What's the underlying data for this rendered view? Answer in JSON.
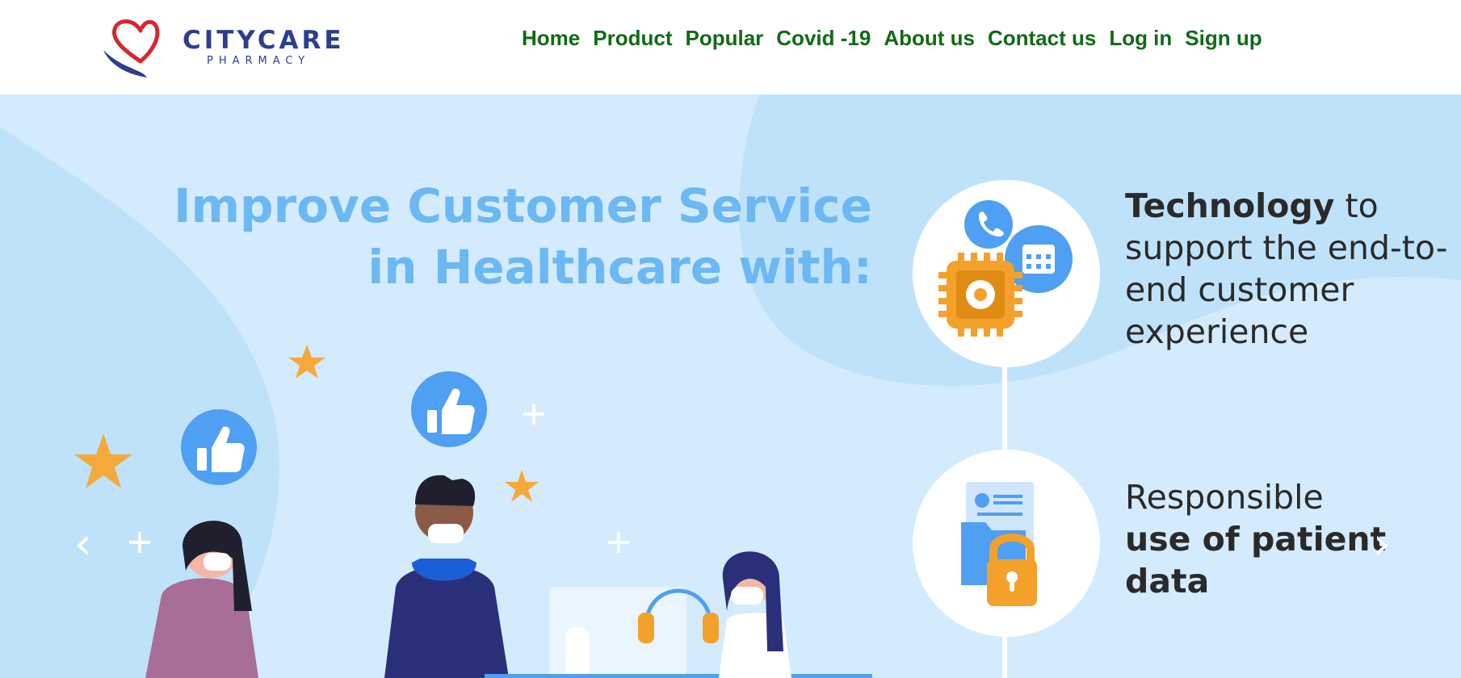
{
  "brand": {
    "name": "CITYCARE",
    "sub": "PHARMACY"
  },
  "nav": {
    "items": [
      "Home",
      "Product",
      "Popular",
      "Covid -19",
      "About us",
      "Contact us",
      "Log in",
      "Sign up"
    ]
  },
  "hero": {
    "headline_line1": "Improve Customer Service",
    "headline_line2": "in Healthcare with:",
    "feature1_bold": "Technology",
    "feature1_rest": " to support the end-to-end customer experience",
    "feature2_regular": "Responsible ",
    "feature2_bold": "use of patient data",
    "prev_arrow": "‹",
    "next_arrow": "›"
  },
  "colors": {
    "nav_green": "#0f6b14",
    "brand_blue": "#2c3e8f",
    "brand_red": "#d8262e",
    "hero_bg": "#d3ebfd",
    "headline_blue": "#6bb8f2",
    "icon_blue": "#4f9ff2",
    "icon_orange": "#f3a12b"
  }
}
